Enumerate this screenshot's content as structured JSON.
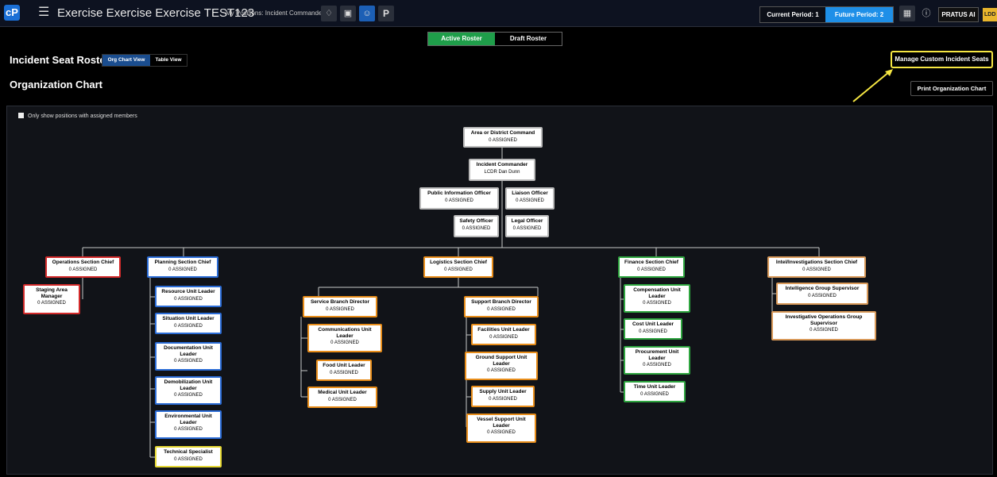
{
  "header": {
    "logo": "cP",
    "title": "Exercise Exercise Exercise TEST123",
    "positions_label": "My Positions: Incident Commander",
    "icons": [
      "bell-icon",
      "calendar-icon",
      "people-icon"
    ],
    "p_label": "P",
    "current_period": "Current Period: 1",
    "future_period": "Future Period: 2",
    "pratus_label": "PRATUS AI",
    "user_badge": "LDD"
  },
  "roster": {
    "active_label": "Active Roster",
    "draft_label": "Draft Roster"
  },
  "page": {
    "seat_roster_title": "Incident Seat Roster",
    "org_chart_view": "Org Chart View",
    "table_view": "Table View",
    "org_chart_title": "Organization Chart",
    "manage_button": "Manage Custom Incident Seats",
    "print_button": "Print Organization Chart",
    "only_show_label": "Only show positions with assigned members"
  },
  "nodes": {
    "area": {
      "name": "Area or District Command",
      "status": "0 ASSIGNED"
    },
    "ic": {
      "name": "Incident Commander",
      "status": "LCDR Dan Dunn"
    },
    "pio": {
      "name": "Public Information Officer",
      "status": "0 ASSIGNED"
    },
    "liaison": {
      "name": "Liaison Officer",
      "status": "0 ASSIGNED"
    },
    "safety": {
      "name": "Safety Officer",
      "status": "0 ASSIGNED"
    },
    "legal": {
      "name": "Legal Officer",
      "status": "0 ASSIGNED"
    },
    "ops": {
      "name": "Operations Section Chief",
      "status": "0 ASSIGNED"
    },
    "staging": {
      "name": "Staging Area Manager",
      "status": "0 ASSIGNED"
    },
    "planning": {
      "name": "Planning Section Chief",
      "status": "0 ASSIGNED"
    },
    "resource": {
      "name": "Resource Unit Leader",
      "status": "0 ASSIGNED"
    },
    "situation": {
      "name": "Situation Unit Leader",
      "status": "0 ASSIGNED"
    },
    "documentation": {
      "name": "Documentation Unit Leader",
      "status": "0 ASSIGNED"
    },
    "demob": {
      "name": "Demobilization Unit Leader",
      "status": "0 ASSIGNED"
    },
    "environmental": {
      "name": "Environmental Unit Leader",
      "status": "0 ASSIGNED"
    },
    "technical": {
      "name": "Technical Specialist",
      "status": "0 ASSIGNED"
    },
    "logistics": {
      "name": "Logistics Section Chief",
      "status": "0 ASSIGNED"
    },
    "service": {
      "name": "Service Branch Director",
      "status": "0 ASSIGNED"
    },
    "comms": {
      "name": "Communications Unit Leader",
      "status": "0 ASSIGNED"
    },
    "food": {
      "name": "Food Unit Leader",
      "status": "0 ASSIGNED"
    },
    "medical": {
      "name": "Medical Unit Leader",
      "status": "0 ASSIGNED"
    },
    "support": {
      "name": "Support Branch Director",
      "status": "0 ASSIGNED"
    },
    "facilities": {
      "name": "Facilities Unit Leader",
      "status": "0 ASSIGNED"
    },
    "ground": {
      "name": "Ground Support Unit Leader",
      "status": "0 ASSIGNED"
    },
    "supply": {
      "name": "Supply Unit Leader",
      "status": "0 ASSIGNED"
    },
    "vessel": {
      "name": "Vessel Support Unit Leader",
      "status": "0 ASSIGNED"
    },
    "finance": {
      "name": "Finance Section Chief",
      "status": "0 ASSIGNED"
    },
    "compensation": {
      "name": "Compensation Unit Leader",
      "status": "0 ASSIGNED"
    },
    "cost": {
      "name": "Cost Unit Leader",
      "status": "0 ASSIGNED"
    },
    "procurement": {
      "name": "Procurement Unit Leader",
      "status": "0 ASSIGNED"
    },
    "time": {
      "name": "Time Unit Leader",
      "status": "0 ASSIGNED"
    },
    "intel": {
      "name": "Intel/Investigations Section Chief",
      "status": "0 ASSIGNED"
    },
    "intel_group": {
      "name": "Intelligence Group Supervisor",
      "status": "0 ASSIGNED"
    },
    "investigative": {
      "name": "Investigative Operations Group Supervisor",
      "status": "0 ASSIGNED"
    }
  }
}
